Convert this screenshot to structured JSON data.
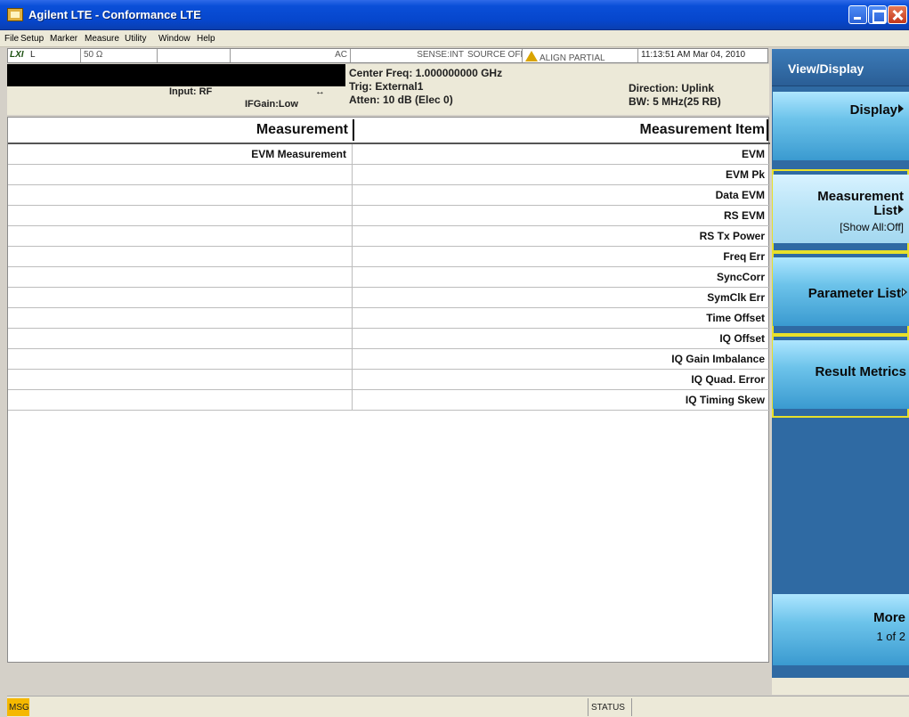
{
  "window": {
    "title": "Agilent LTE - Conformance LTE"
  },
  "menu": [
    "File",
    "Setup",
    "Marker",
    "Measure",
    "Utility",
    "Window",
    "Help"
  ],
  "status_strip": {
    "lxi": "LXI",
    "mode": "L",
    "impedance": "50 Ω",
    "coupling": "AC",
    "sense": "SENSE:INT",
    "source": "SOURCE OFF",
    "align": "ALIGN PARTIAL",
    "datetime": "11:13:51 AM Mar 04, 2010"
  },
  "header": {
    "input": "Input: RF",
    "ifgain": "IFGain:Low",
    "center_freq": "Center Freq: 1.000000000 GHz",
    "trig": "Trig: External1",
    "atten": "Atten: 10 dB (Elec 0)",
    "direction": "Direction: Uplink",
    "bw": "BW: 5 MHz(25 RB)"
  },
  "table": {
    "columns": [
      "Measurement",
      "Measurement Item"
    ],
    "rows": [
      [
        "EVM Measurement",
        "EVM"
      ],
      [
        "",
        "EVM Pk"
      ],
      [
        "",
        "Data EVM"
      ],
      [
        "",
        "RS EVM"
      ],
      [
        "",
        "RS Tx Power"
      ],
      [
        "",
        "Freq Err"
      ],
      [
        "",
        "SyncCorr"
      ],
      [
        "",
        "SymClk Err"
      ],
      [
        "",
        "Time Offset"
      ],
      [
        "",
        "IQ Offset"
      ],
      [
        "",
        "IQ Gain Imbalance"
      ],
      [
        "",
        "IQ Quad. Error"
      ],
      [
        "",
        "IQ Timing Skew"
      ]
    ]
  },
  "softkeys": {
    "title": "View/Display",
    "display": "Display",
    "measurement_list_1": "Measurement",
    "measurement_list_2": "List",
    "measurement_list_sub": "[Show All:Off]",
    "parameter_list": "Parameter List",
    "result_metrics": "Result Metrics",
    "more": "More",
    "more_sub": "1 of 2"
  },
  "bottom": {
    "msg": "MSG",
    "status": "STATUS"
  }
}
